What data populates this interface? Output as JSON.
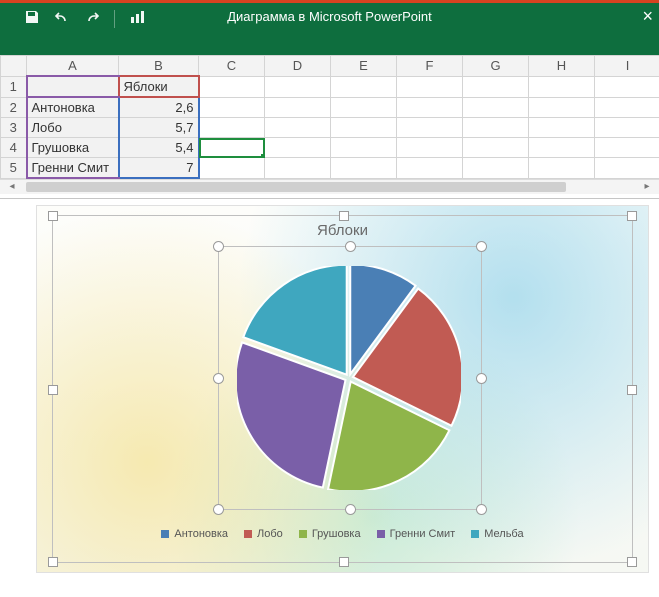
{
  "titlebar": {
    "title": "Диаграмма в Microsoft PowerPoint"
  },
  "columns": [
    "A",
    "B",
    "C",
    "D",
    "E",
    "F",
    "G",
    "H",
    "I"
  ],
  "header_cell": "Яблоки",
  "rows": [
    {
      "n": "1",
      "a": "",
      "b_label": "Яблоки"
    },
    {
      "n": "2",
      "a": "Антоновка",
      "b": "2,6"
    },
    {
      "n": "3",
      "a": "Лобо",
      "b": "5,7"
    },
    {
      "n": "4",
      "a": "Грушовка",
      "b": "5,4"
    },
    {
      "n": "5",
      "a": "Гренни Смит",
      "b": "7"
    }
  ],
  "chart_data": {
    "type": "pie",
    "title": "Яблоки",
    "series_name": "Яблоки",
    "categories": [
      "Антоновка",
      "Лобо",
      "Грушовка",
      "Гренни Смит",
      "Мельба"
    ],
    "values": [
      2.6,
      5.7,
      5.4,
      7,
      5
    ],
    "colors": [
      "#4a7fb5",
      "#c15b53",
      "#8fb54a",
      "#7a5fa8",
      "#3fa7bf"
    ],
    "legend_position": "bottom"
  },
  "legend": {
    "items": [
      {
        "label": "Антоновка",
        "color": "#4a7fb5"
      },
      {
        "label": "Лобо",
        "color": "#c15b53"
      },
      {
        "label": "Грушовка",
        "color": "#8fb54a"
      },
      {
        "label": "Гренни Смит",
        "color": "#7a5fa8"
      },
      {
        "label": "Мельба",
        "color": "#3fa7bf"
      }
    ]
  }
}
